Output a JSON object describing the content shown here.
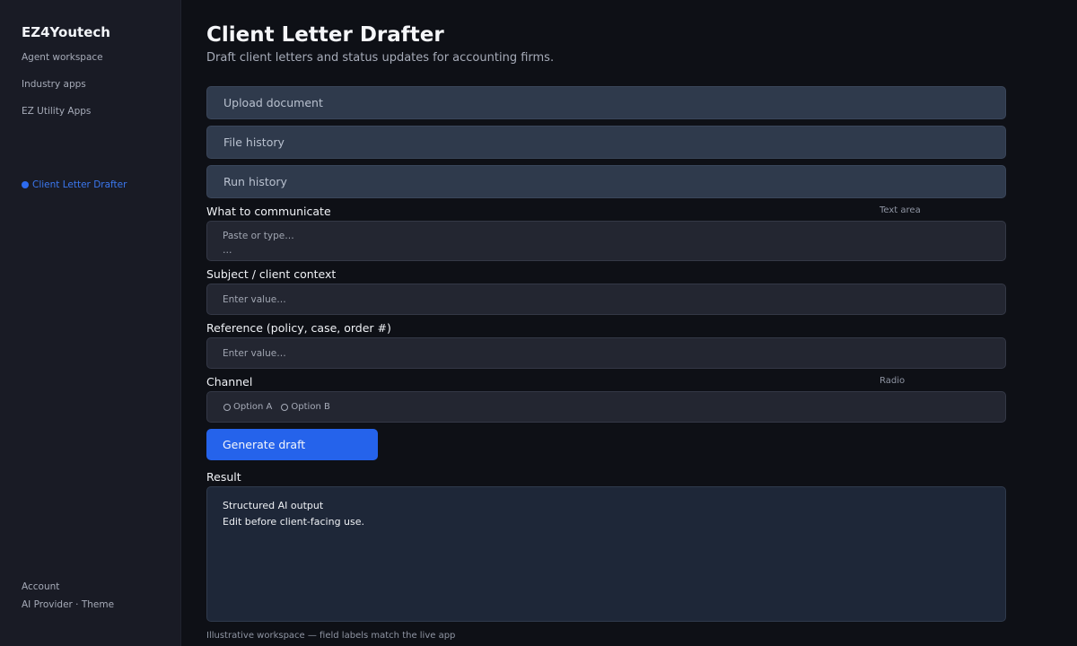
{
  "sidebar": {
    "brand": "EZ4Youtech",
    "nav": [
      {
        "label": "Agent workspace"
      },
      {
        "label": "Industry apps"
      },
      {
        "label": "EZ Utility Apps"
      }
    ],
    "active_app": "Client Letter Drafter",
    "footer": {
      "account": "Account",
      "provider_theme": "AI Provider · Theme"
    }
  },
  "header": {
    "title": "Client Letter Drafter",
    "subtitle": "Draft client letters and status updates for accounting firms."
  },
  "sections": [
    {
      "label": "Upload document"
    },
    {
      "label": "File history"
    },
    {
      "label": "Run history"
    }
  ],
  "form": {
    "communicate": {
      "label": "What to communicate",
      "hint": "Text area",
      "placeholder": "Paste or type…\n…"
    },
    "subject": {
      "label": "Subject / client context",
      "placeholder": "Enter value…"
    },
    "reference": {
      "label": "Reference (policy, case, order #)",
      "placeholder": "Enter value…"
    },
    "channel": {
      "label": "Channel",
      "hint": "Radio",
      "options": [
        "Option A",
        "Option B"
      ]
    },
    "generate_label": "Generate draft"
  },
  "result": {
    "label": "Result",
    "line1": "Structured AI output",
    "line2": "Edit before client-facing use."
  },
  "footnote": "Illustrative workspace — field labels match the live app",
  "colors": {
    "accent": "#2563eb",
    "active_nav": "#3b78f0",
    "background": "#0e1016",
    "sidebar": "#191b25"
  }
}
